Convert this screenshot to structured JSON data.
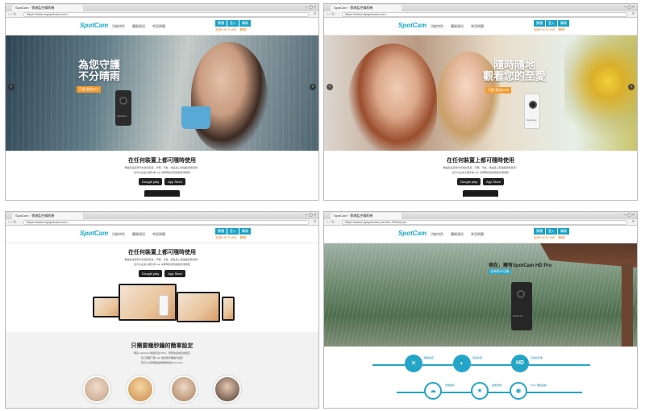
{
  "browser": {
    "tab_title": "SpotCam · 雲端監控攝影機",
    "url": "https://www.myspotcam.com",
    "url_full": "https://www.myspotcam.com/zh-TW/hd-pro"
  },
  "site": {
    "logo": "SpotCam",
    "nav": [
      "功能特色",
      "購買資訊",
      "常見問題"
    ],
    "top_buttons": [
      "繁體",
      "登入",
      "購買"
    ],
    "lang_links": [
      "全球 HOTLINE",
      "聯絡"
    ]
  },
  "hero1": {
    "title_line1": "為您守護",
    "title_line2": "不分晴雨",
    "badge": "只要 美金$79",
    "cam_brand": "SpotCam"
  },
  "hero2": {
    "title_line1": "隨時隨地",
    "title_line2": "觀看您的至愛",
    "badge": "只要 美金$149",
    "cam_brand": "SpotCam"
  },
  "content": {
    "heading": "在任何裝置上都可隨時使用",
    "desc1": "無論您是使用什麼樣的裝置，手機、平板、或是桌上型電腦皆能使用！",
    "desc2": "您可以在電子郵件或 App 中即時接收到移動偵測通知",
    "google_play": "Google play",
    "app_store": "App Store"
  },
  "setup": {
    "heading": "只需要幾秒鐘的簡單設定",
    "desc1": "購買 SpotCam 後連接到 Wi-Fi，輕鬆快速地完成設定",
    "desc2": "您只需要下載 App 並依照步驟進行設定",
    "desc3": "就可以立即開始遠端觀看您的 SpotCam"
  },
  "hero4": {
    "title": "現在，擁有SpotCam HD Pro",
    "subtitle": "全新防水功能",
    "cam_brand": "SpotCam"
  },
  "features": {
    "f1": "無線設定",
    "f2": "夜視功能",
    "f3": "高畫質影像",
    "f4": "雲端錄影",
    "f5": "免費雲端",
    "f6": "Wi-Fi 無線連線",
    "hd_label": "HD"
  },
  "icons": {
    "back": "arrow-left-icon",
    "forward": "arrow-right-icon",
    "reload": "reload-icon",
    "menu": "hamburger-icon"
  },
  "colors": {
    "brand": "#15a5c8",
    "orange": "#f29a2f"
  }
}
